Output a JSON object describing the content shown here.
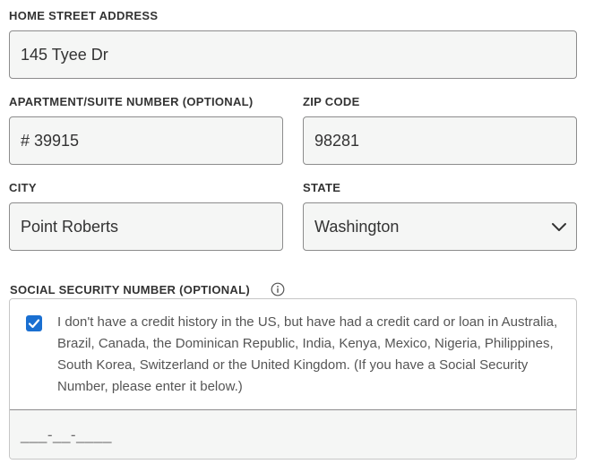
{
  "address": {
    "label": "HOME STREET ADDRESS",
    "value": "145 Tyee Dr"
  },
  "apartment": {
    "label": "APARTMENT/SUITE NUMBER (OPTIONAL)",
    "value": "# 39915"
  },
  "zip": {
    "label": "ZIP CODE",
    "value": "98281"
  },
  "city": {
    "label": "CITY",
    "value": "Point Roberts"
  },
  "state": {
    "label": "STATE",
    "value": "Washington"
  },
  "ssn": {
    "label": "SOCIAL SECURITY NUMBER (OPTIONAL)",
    "info_icon": "info-circle-icon",
    "checkbox_checked": true,
    "checkbox_text": "I don't have a credit history in the US, but have had a credit card or loan in Australia, Brazil, Canada, the Dominican Republic, India, Kenya, Mexico, Nigeria, Philippines, South Korea, Switzerland or the United Kingdom. (If you have a Social Security Number, please enter it below.)",
    "input_placeholder": "___-__-____"
  },
  "colors": {
    "accent": "#1a6fd1",
    "field_background": "#f5f6f5",
    "field_border": "#8c8c8c"
  }
}
